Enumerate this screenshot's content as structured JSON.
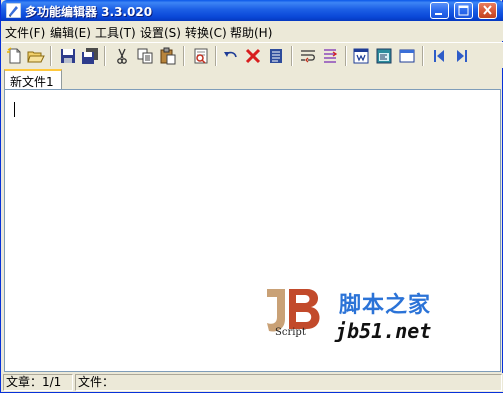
{
  "window": {
    "title": "多功能编辑器 3.3.020",
    "icon": "pen-icon"
  },
  "menubar": {
    "items": [
      {
        "label": "文件(F)"
      },
      {
        "label": "编辑(E)"
      },
      {
        "label": "工具(T)"
      },
      {
        "label": "设置(S)"
      },
      {
        "label": "转换(C)"
      },
      {
        "label": "帮助(H)"
      }
    ]
  },
  "toolbar": {
    "buttons": [
      {
        "icon": "new-file-icon"
      },
      {
        "icon": "open-folder-icon"
      },
      {
        "icon": "save-icon"
      },
      {
        "icon": "save-all-icon"
      },
      {
        "icon": "cut-icon"
      },
      {
        "icon": "copy-icon"
      },
      {
        "icon": "paste-icon"
      },
      {
        "icon": "find-replace-icon"
      },
      {
        "icon": "undo-icon"
      },
      {
        "icon": "delete-icon"
      },
      {
        "icon": "document-icon"
      },
      {
        "icon": "word-wrap-icon"
      },
      {
        "icon": "indent-icon"
      },
      {
        "icon": "view-html-icon"
      },
      {
        "icon": "view-code-icon"
      },
      {
        "icon": "window-icon"
      },
      {
        "icon": "previous-icon"
      },
      {
        "icon": "next-icon"
      }
    ]
  },
  "tabs": [
    {
      "label": "新文件1",
      "active": true
    }
  ],
  "watermark": {
    "logo_text": "JB",
    "logo_subtext": "Script",
    "chinese": "脚本之家",
    "site": "jb51.net"
  },
  "statusbar": {
    "article": "文章：1/1",
    "file": "文件："
  },
  "colors": {
    "title_bar": "#0A48D8",
    "accent_tab": "#FFC83C",
    "watermark_blue": "#2B73D7",
    "logo_orange": "#D6733A"
  }
}
